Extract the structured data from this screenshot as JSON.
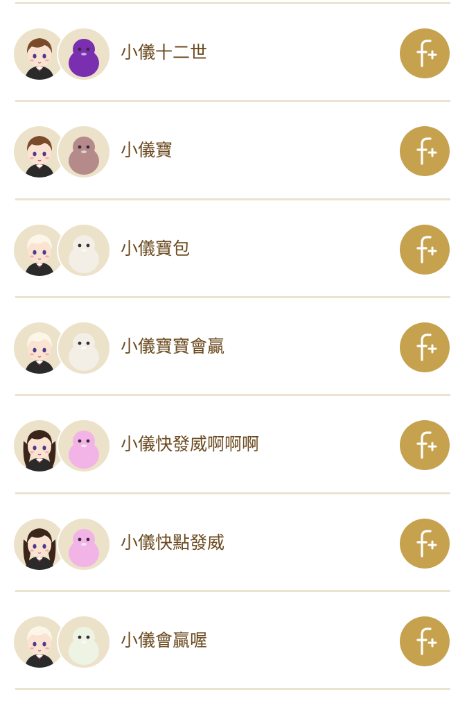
{
  "friends": [
    {
      "name": "小儀十二世",
      "avatar_icon": "girl-bob-hair-avatar-icon",
      "pet_icon": "purple-monster-pet-icon",
      "pet_color": "#7a2fb0",
      "hair_color": "#7a4a2a",
      "follow_icon": "follow-plus-icon"
    },
    {
      "name": "小儀寶",
      "avatar_icon": "girl-bunny-ears-avatar-icon",
      "pet_icon": "brown-rabbit-pet-icon",
      "pet_color": "#b48a8a",
      "hair_color": "#7a4a2a",
      "follow_icon": "follow-plus-icon"
    },
    {
      "name": "小儀寶包",
      "avatar_icon": "girl-white-hair-avatar-icon",
      "pet_icon": "white-alpaca-pet-icon",
      "pet_color": "#f3efe6",
      "hair_color": "#fbf6e8",
      "follow_icon": "follow-plus-icon"
    },
    {
      "name": "小儀寶寶會贏",
      "avatar_icon": "girl-white-hair-ghost-hat-avatar-icon",
      "pet_icon": "white-alpaca-ghost-pet-icon",
      "pet_color": "#f3efe6",
      "hair_color": "#fbf6e8",
      "follow_icon": "follow-plus-icon"
    },
    {
      "name": "小儀快發威啊啊啊",
      "avatar_icon": "girl-long-dark-hair-avatar-icon",
      "pet_icon": "pink-fluffy-pet-icon",
      "pet_color": "#f2b4e6",
      "hair_color": "#3b2418",
      "follow_icon": "follow-plus-icon"
    },
    {
      "name": "小儀快點發威",
      "avatar_icon": "girl-long-dark-hair-avatar-icon",
      "pet_icon": "pink-fluffy-pet-icon",
      "pet_color": "#f2b4e6",
      "hair_color": "#3b2418",
      "follow_icon": "follow-plus-icon"
    },
    {
      "name": "小儀會贏喔",
      "avatar_icon": "girl-white-hair-ghost-hat-avatar-icon",
      "pet_icon": "white-alpaca-ghost-pet-icon",
      "pet_color": "#eef4e4",
      "hair_color": "#fbf6e8",
      "follow_icon": "follow-plus-icon"
    }
  ],
  "colors": {
    "accent": "#c6a24f",
    "name_text": "#6b4a1f",
    "divider": "#ebe2cf",
    "avatar_bg": "#ece1c9"
  }
}
